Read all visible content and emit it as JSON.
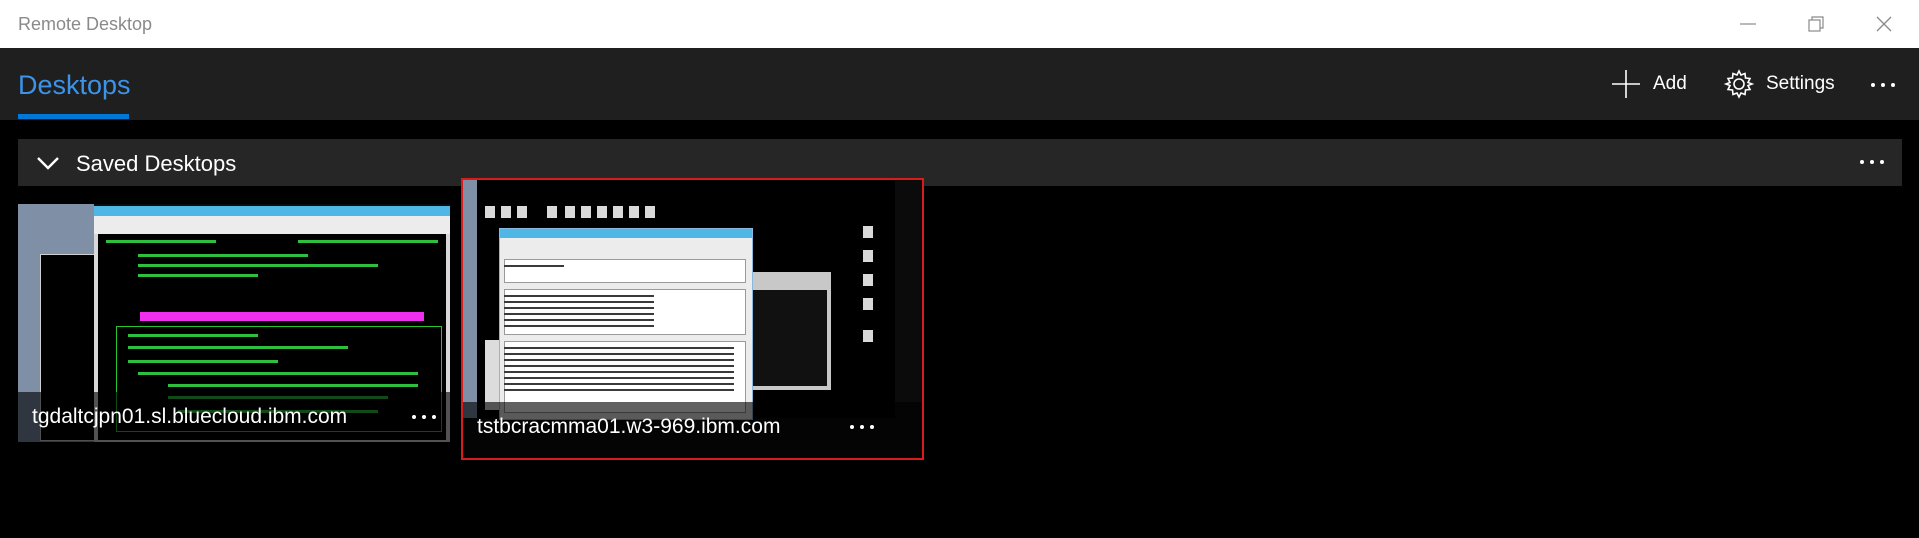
{
  "window": {
    "title": "Remote Desktop",
    "controls": [
      "minimize",
      "restore",
      "close"
    ]
  },
  "header": {
    "tab_label": "Desktops",
    "add_label": "Add",
    "settings_label": "Settings"
  },
  "section": {
    "title": "Saved Desktops"
  },
  "desktops": [
    {
      "name": "tgdaltcjpn01.sl.bluecloud.ibm.com",
      "selected": false
    },
    {
      "name": "tstbcracmma01.w3-969.ibm.com",
      "selected": true
    }
  ],
  "colors": {
    "accent": "#0078d7",
    "selection_border": "#d81b1b",
    "header_bg": "#1f1f1f",
    "section_bg": "#262626"
  }
}
